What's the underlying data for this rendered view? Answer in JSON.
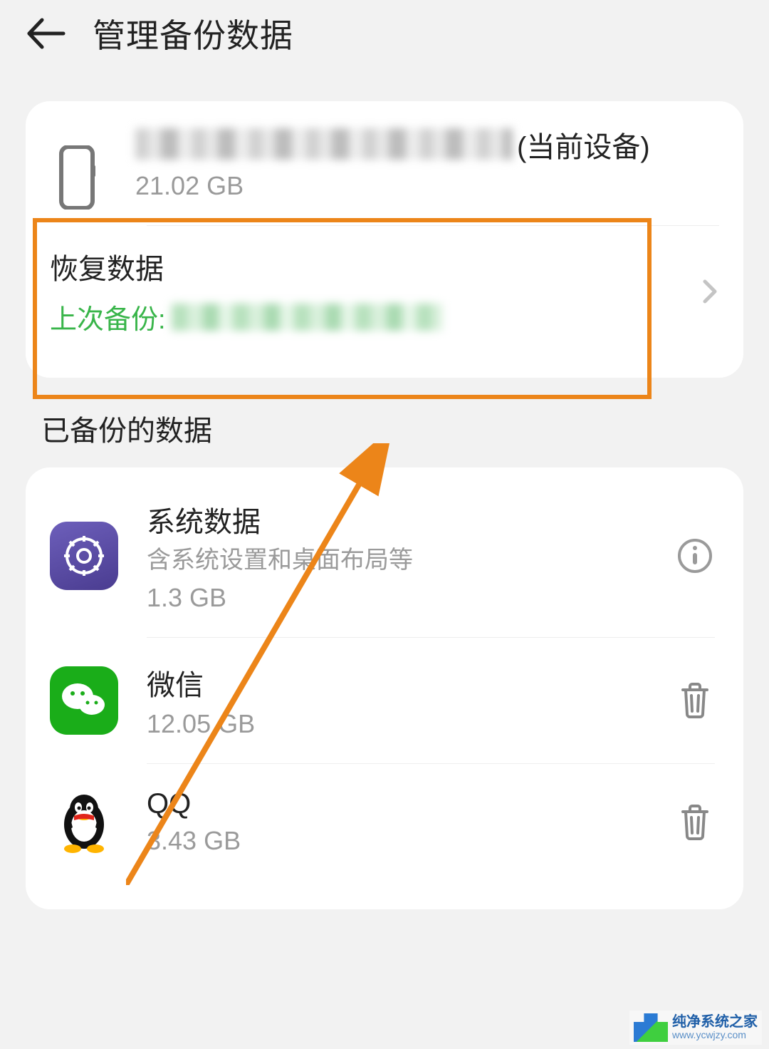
{
  "header": {
    "title": "管理备份数据"
  },
  "device": {
    "suffix": "(当前设备)",
    "size": "21.02 GB"
  },
  "restore": {
    "title": "恢复数据",
    "sub_label": "上次备份:"
  },
  "section": {
    "backed_up_title": "已备份的数据"
  },
  "items": [
    {
      "name": "系统数据",
      "desc": "含系统设置和桌面布局等",
      "size": "1.3 GB",
      "icon": "system",
      "action": "info"
    },
    {
      "name": "微信",
      "desc": "",
      "size": "12.05 GB",
      "icon": "wechat",
      "action": "delete"
    },
    {
      "name": "QQ",
      "desc": "",
      "size": "3.43 GB",
      "icon": "qq",
      "action": "delete"
    }
  ],
  "watermark": {
    "top": "纯净系统之家",
    "bottom": "www.ycwjzy.com"
  }
}
